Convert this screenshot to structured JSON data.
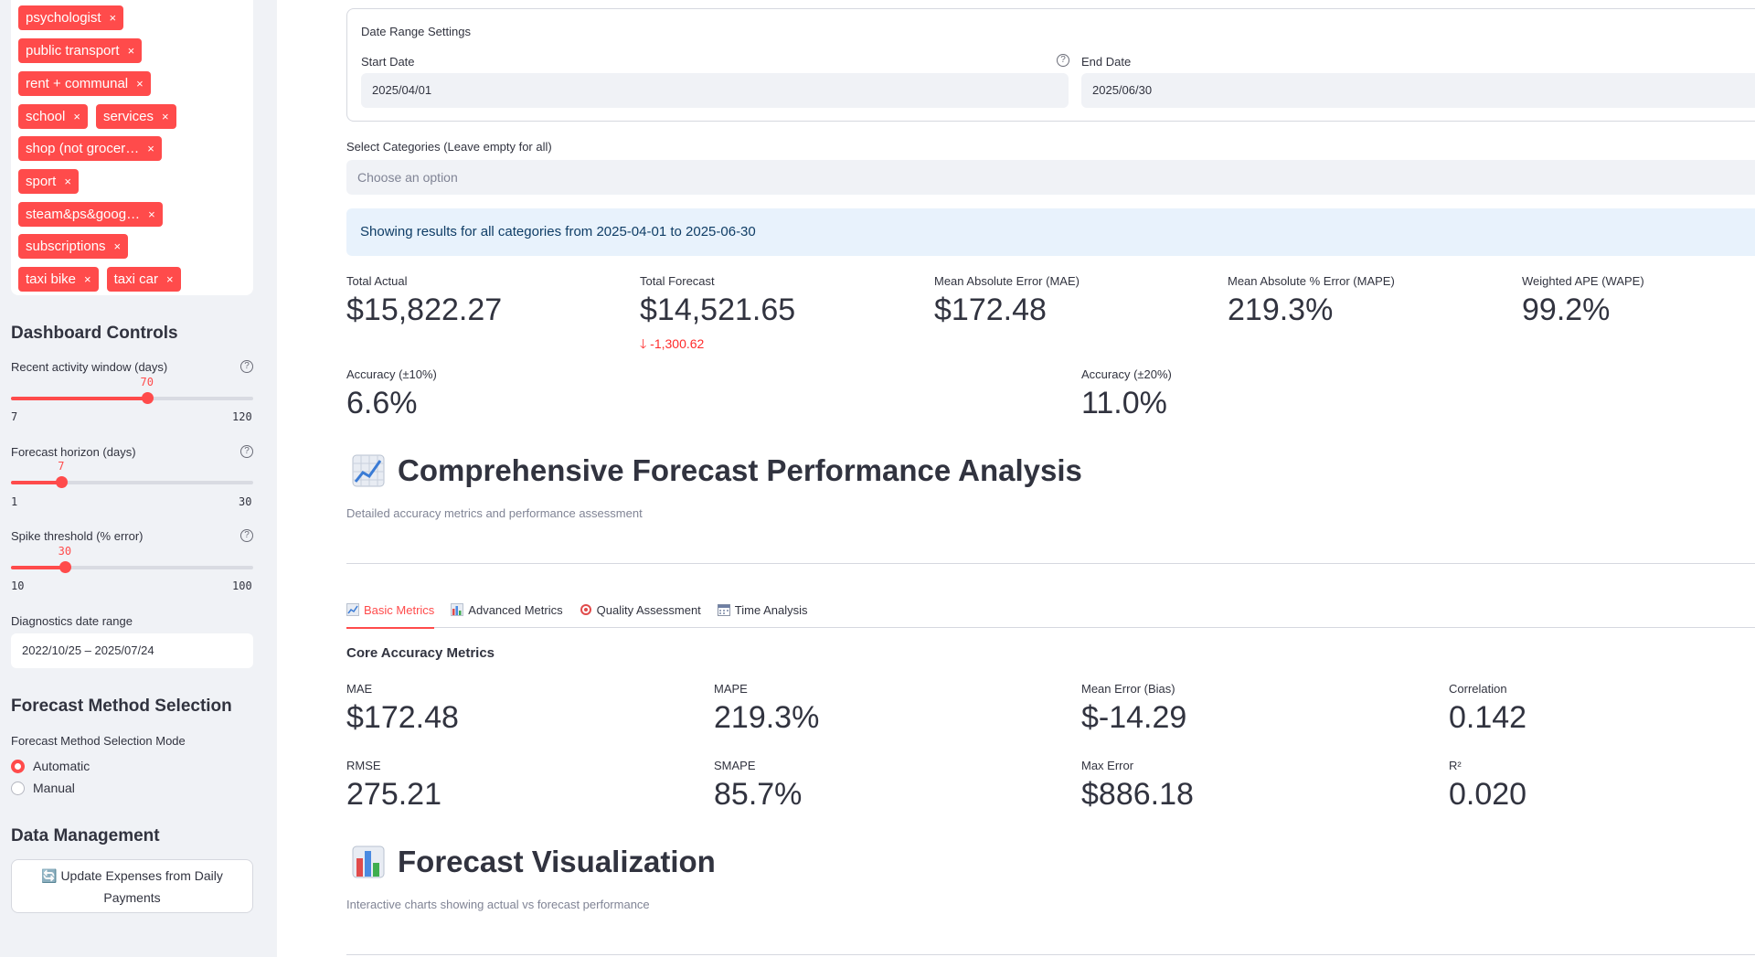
{
  "sidebar": {
    "tag_rows": [
      [
        {
          "label": "psychologist"
        }
      ],
      [
        {
          "label": "public transport"
        }
      ],
      [
        {
          "label": "rent + communal"
        }
      ],
      [
        {
          "label": "school"
        },
        {
          "label": "services"
        }
      ],
      [
        {
          "label": "shop (not grocer…"
        }
      ],
      [
        {
          "label": "sport"
        }
      ],
      [
        {
          "label": "steam&ps&goog…"
        }
      ],
      [
        {
          "label": "subscriptions"
        }
      ],
      [
        {
          "label": "taxi bike"
        },
        {
          "label": "taxi car"
        }
      ]
    ],
    "tag_remove_glyph": "×",
    "dashboard_controls_title": "Dashboard Controls",
    "sliders": [
      {
        "label": "Recent activity window (days)",
        "value": "70",
        "min": "7",
        "max": "120",
        "fraction": 0.5614
      },
      {
        "label": "Forecast horizon (days)",
        "value": "7",
        "min": "1",
        "max": "30",
        "fraction": 0.2069
      },
      {
        "label": "Spike threshold (% error)",
        "value": "30",
        "min": "10",
        "max": "100",
        "fraction": 0.2222
      }
    ],
    "diagnostics_label": "Diagnostics date range",
    "diagnostics_value": "2022/10/25 – 2025/07/24",
    "forecast_method_title": "Forecast Method Selection",
    "mode_label": "Forecast Method Selection Mode",
    "mode_options": [
      {
        "label": "Automatic",
        "selected": true
      },
      {
        "label": "Manual",
        "selected": false
      }
    ],
    "data_management_title": "Data Management",
    "update_button": "🔄 Update Expenses from Daily Payments"
  },
  "main": {
    "date_settings_title": "Date Range Settings",
    "start_date_label": "Start Date",
    "start_date_value": "2025/04/01",
    "end_date_label": "End Date",
    "end_date_value": "2025/06/30",
    "categories_label": "Select Categories (Leave empty for all)",
    "categories_placeholder": "Choose an option",
    "info_text": "Showing results for all categories from 2025-04-01 to 2025-06-30",
    "summary_metrics": [
      {
        "label": "Total Actual",
        "value": "$15,822.27"
      },
      {
        "label": "Total Forecast",
        "value": "$14,521.65",
        "delta": "-1,300.62"
      },
      {
        "label": "Mean Absolute Error (MAE)",
        "value": "$172.48"
      },
      {
        "label": "Mean Absolute % Error (MAPE)",
        "value": "219.3%"
      },
      {
        "label": "Weighted APE (WAPE)",
        "value": "99.2%"
      }
    ],
    "accuracy_metrics": [
      {
        "label": "Accuracy (±10%)",
        "value": "6.6%"
      },
      {
        "label": "Accuracy (±20%)",
        "value": "11.0%"
      }
    ],
    "analysis_title": "Comprehensive Forecast Performance Analysis",
    "analysis_caption": "Detailed accuracy metrics and performance assessment",
    "tabs": [
      {
        "label": "Basic Metrics",
        "icon": "chart-up-icon",
        "active": true
      },
      {
        "label": "Advanced Metrics",
        "icon": "bar-chart-icon",
        "active": false
      },
      {
        "label": "Quality Assessment",
        "icon": "target-icon",
        "active": false
      },
      {
        "label": "Time Analysis",
        "icon": "calendar-icon",
        "active": false
      }
    ],
    "core_title": "Core Accuracy Metrics",
    "core_metrics": [
      {
        "label": "MAE",
        "value": "$172.48"
      },
      {
        "label": "MAPE",
        "value": "219.3%"
      },
      {
        "label": "Mean Error (Bias)",
        "value": "$-14.29"
      },
      {
        "label": "Correlation",
        "value": "0.142"
      },
      {
        "label": "RMSE",
        "value": "275.21"
      },
      {
        "label": "SMAPE",
        "value": "85.7%"
      },
      {
        "label": "Max Error",
        "value": "$886.18"
      },
      {
        "label": "R²",
        "value": "0.020"
      }
    ],
    "viz_title": "Forecast Visualization",
    "viz_caption": "Interactive charts showing actual vs forecast performance"
  },
  "colors": {
    "accent": "#ff4b4b",
    "sidebar_bg": "#f0f2f6",
    "info_bg": "#e8f2fc"
  }
}
